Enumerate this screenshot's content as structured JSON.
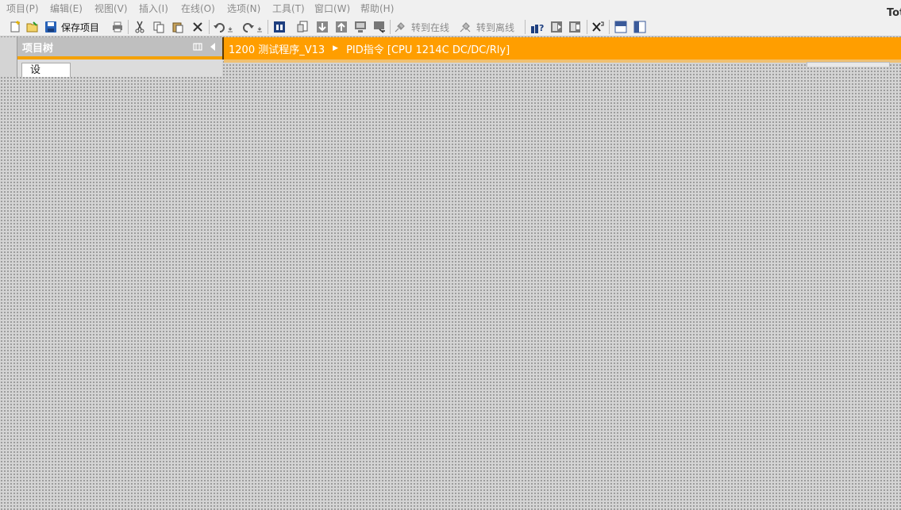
{
  "menu": {
    "items": [
      {
        "label": "项目(P)",
        "name": "menu-project"
      },
      {
        "label": "编辑(E)",
        "name": "menu-edit"
      },
      {
        "label": "视图(V)",
        "name": "menu-view"
      },
      {
        "label": "插入(I)",
        "name": "menu-insert"
      },
      {
        "label": "在线(O)",
        "name": "menu-online"
      },
      {
        "label": "选项(N)",
        "name": "menu-options"
      },
      {
        "label": "工具(T)",
        "name": "menu-tools"
      },
      {
        "label": "窗口(W)",
        "name": "menu-window"
      },
      {
        "label": "帮助(H)",
        "name": "menu-help"
      }
    ],
    "brand": "Tot"
  },
  "toolbar": {
    "save_label": "保存项目",
    "go_online_label": "转到在线",
    "go_offline_label": "转到离线"
  },
  "project_tree": {
    "title": "项目树",
    "tab_label": "设"
  },
  "breadcrumb": {
    "project": "1200 测试程序_V13",
    "device": "PID指令 [CPU 1214C DC/DC/Rly]"
  },
  "colors": {
    "accent": "#ff9e00",
    "menu_text": "#8a8a8a",
    "workspace": "#d4d4d4"
  }
}
